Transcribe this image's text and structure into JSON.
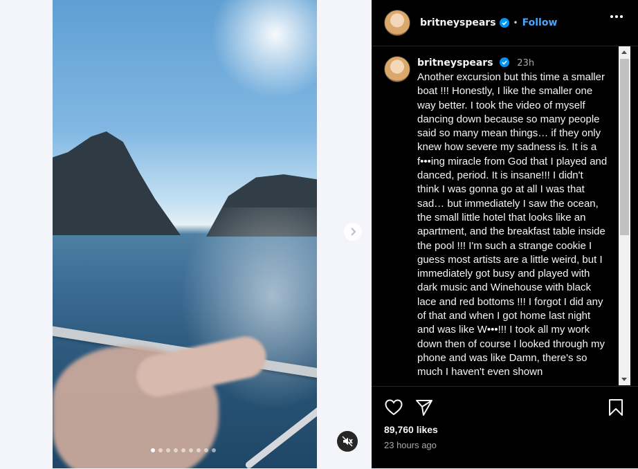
{
  "post": {
    "username": "britneyspears",
    "follow_label": "Follow",
    "separator": "•",
    "time_ago": "23h",
    "caption": "Another excursion but this time a smaller boat !!! Honestly, I like the smaller one way better. I took the video of myself dancing down because so many people said so many mean things… if they only knew how severe my sadness is. It is a f•••ing miracle from God that I played and danced, period. It is insane!!! I didn't think I was gonna go at all I was that sad… but immediately I saw the ocean, the small little hotel that looks like an apartment, and the breakfast table inside the pool !!! I'm such a strange cookie I guess most artists are a little weird, but I immediately got busy and played with dark music and Winehouse with black lace and red bottoms !!! I forgot I did any of that and when I got home last night and was like W•••!!! I took all my work down then of course I looked through my phone and was like Damn, there's so much I haven't even shown",
    "likes": "89,760 likes",
    "posted": "23 hours ago"
  },
  "media": {
    "carousel_total": 9,
    "carousel_current": 1
  },
  "icons": {
    "verified": "verified-badge-icon",
    "more": "more-options-icon",
    "like": "heart-icon",
    "share": "share-icon",
    "save": "bookmark-icon",
    "next": "chevron-right-icon",
    "mute": "mute-icon"
  },
  "colors": {
    "accent": "#4aa6ff",
    "verified": "#0095f6",
    "panel_bg": "#000000"
  }
}
